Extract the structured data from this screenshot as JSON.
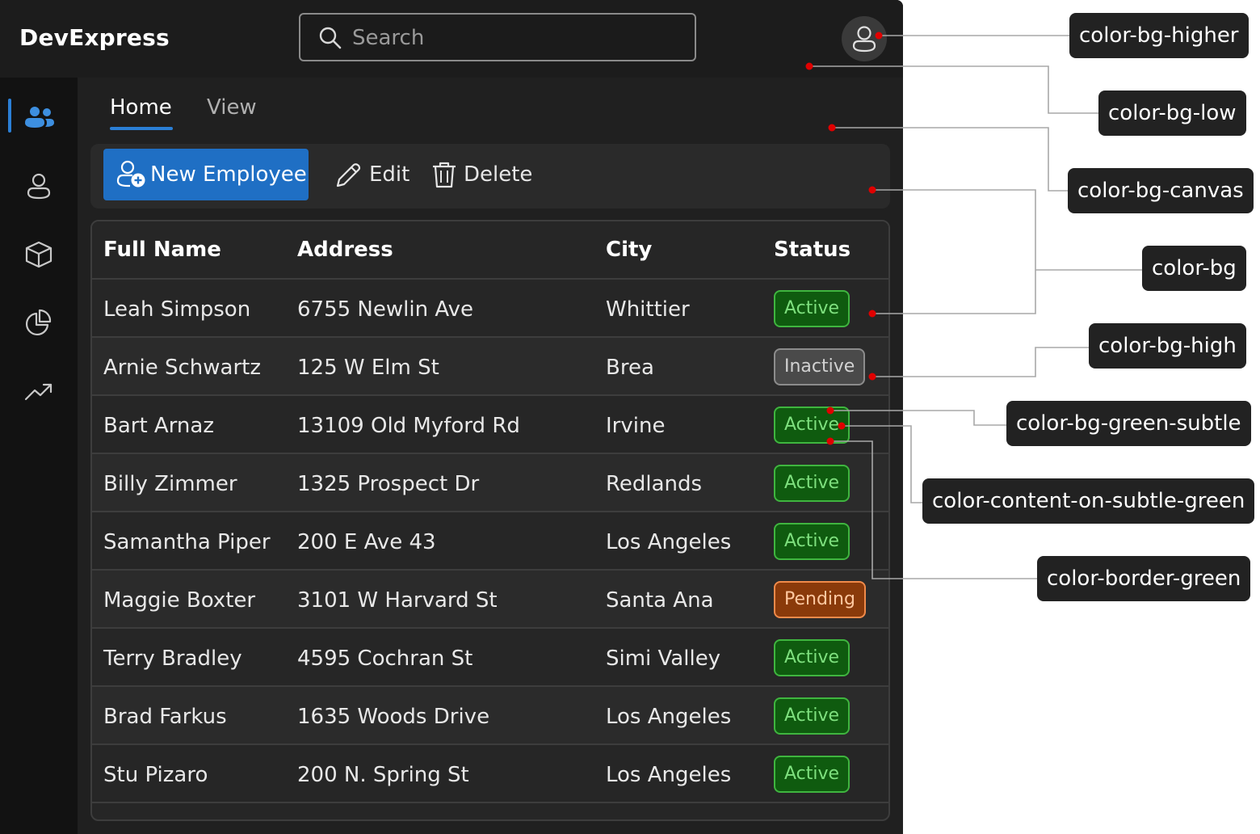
{
  "app": {
    "title": "DevExpress"
  },
  "search": {
    "placeholder": "Search",
    "value": ""
  },
  "tabs": [
    {
      "label": "Home",
      "active": true
    },
    {
      "label": "View",
      "active": false
    }
  ],
  "toolbar": {
    "new_label": "New Employee",
    "edit_label": "Edit",
    "delete_label": "Delete"
  },
  "rail": {
    "items": [
      "people-icon",
      "person-icon",
      "cube-icon",
      "pie-chart-icon",
      "trend-icon"
    ],
    "selected": 0
  },
  "table": {
    "columns": [
      "Full Name",
      "Address",
      "City",
      "Status"
    ],
    "rows": [
      {
        "name": "Leah Simpson",
        "address": "6755 Newlin Ave",
        "city": "Whittier",
        "status": "Active"
      },
      {
        "name": "Arnie Schwartz",
        "address": "125 W Elm St",
        "city": "Brea",
        "status": "Inactive"
      },
      {
        "name": "Bart Arnaz",
        "address": "13109 Old Myford Rd",
        "city": "Irvine",
        "status": "Active"
      },
      {
        "name": "Billy Zimmer",
        "address": "1325 Prospect Dr",
        "city": "Redlands",
        "status": "Active"
      },
      {
        "name": "Samantha Piper",
        "address": "200 E Ave 43",
        "city": "Los Angeles",
        "status": "Active"
      },
      {
        "name": "Maggie Boxter",
        "address": "3101 W Harvard St",
        "city": "Santa Ana",
        "status": "Pending"
      },
      {
        "name": "Terry Bradley",
        "address": "4595 Cochran St",
        "city": "Simi Valley",
        "status": "Active"
      },
      {
        "name": "Brad Farkus",
        "address": "1635 Woods Drive",
        "city": "Los Angeles",
        "status": "Active"
      },
      {
        "name": "Stu Pizaro",
        "address": "200 N. Spring St",
        "city": "Los Angeles",
        "status": "Active"
      }
    ]
  },
  "callouts": [
    "color-bg-higher",
    "color-bg-low",
    "color-bg-canvas",
    "color-bg",
    "color-bg-high",
    "color-bg-green-subtle",
    "color-content-on-subtle-green",
    "color-border-green"
  ],
  "colors": {
    "accent": "#1f6fc4",
    "marker": "#e00000",
    "active_bg": "#0f5b0f",
    "active_border": "#3fb53f",
    "active_text": "#7ee07e",
    "pending_bg": "#8a3a0a",
    "inactive_bg": "#4a4a4a"
  }
}
